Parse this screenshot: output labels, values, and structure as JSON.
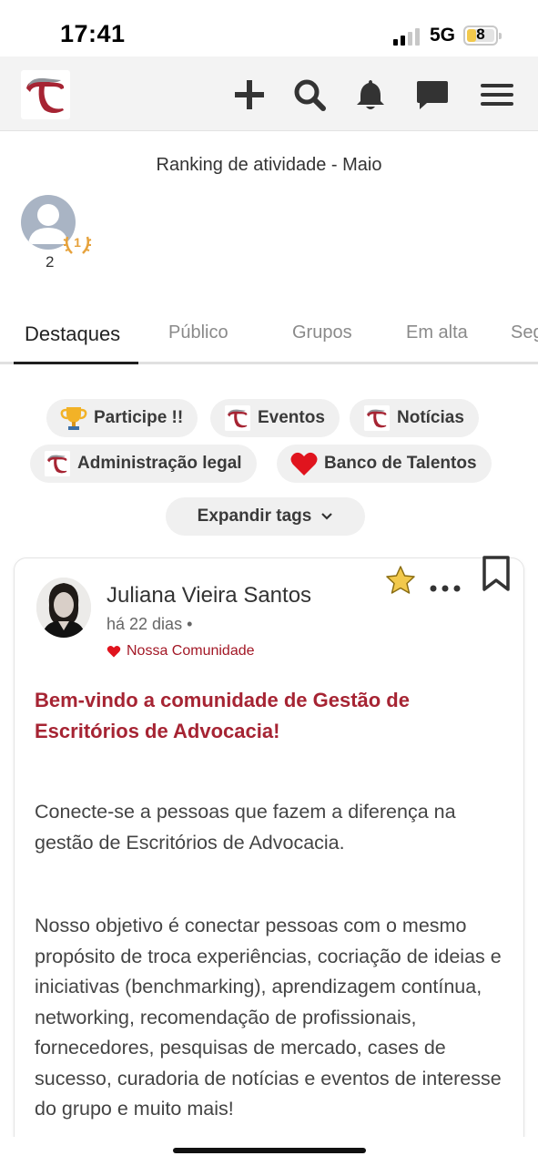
{
  "status_bar": {
    "time": "17:41",
    "network": "5G",
    "battery": "8"
  },
  "header": {
    "icons": [
      "plus-icon",
      "search-icon",
      "bell-icon",
      "chat-icon",
      "menu-icon"
    ]
  },
  "ranking": {
    "title": "Ranking de atividade - Maio",
    "user_count": "2",
    "badge": "1"
  },
  "tabs": [
    {
      "label": "Destaques",
      "active": true
    },
    {
      "label": "Público"
    },
    {
      "label": "Grupos"
    },
    {
      "label": "Em alta"
    },
    {
      "label": "Seg"
    }
  ],
  "tags": [
    {
      "label": "Participe !!",
      "icon": "trophy-icon"
    },
    {
      "label": "Eventos",
      "icon": "logo-icon"
    },
    {
      "label": "Notícias",
      "icon": "logo-icon"
    },
    {
      "label": "Administração legal",
      "icon": "logo-icon"
    },
    {
      "label": "Banco de Talentos",
      "icon": "heart-icon"
    }
  ],
  "expand_tags": "Expandir tags",
  "post": {
    "author": "Juliana Vieira Santos",
    "time": "há 22 dias •",
    "community": "Nossa Comunidade",
    "title": "Bem-vindo a comunidade de Gestão de Escritórios de Advocacia!",
    "paragraphs": [
      "Conecte-se a pessoas que fazem a diferença na gestão de Escritórios de Advocacia.",
      "Nosso objetivo é conectar pessoas com o mesmo propósito de troca experiências, cocriação de ideias e iniciativas (benchmarking), aprendizagem contínua,  networking, recomendação de profissionais, fornecedores, pesquisas de mercado, cases de sucesso, curadoria de notícias e eventos de interesse do grupo e muito mais!"
    ]
  },
  "colors": {
    "brand_red": "#a62433",
    "accent_gold": "#f2c94c"
  }
}
